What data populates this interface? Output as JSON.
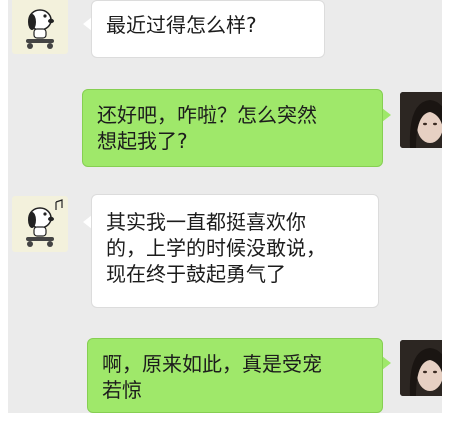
{
  "conversation": {
    "messages": [
      {
        "sender": "friend",
        "lines": [
          "最近过得怎么样?"
        ]
      },
      {
        "sender": "me",
        "lines": [
          "还好吧，咋啦？怎么突然",
          "想起我了?"
        ]
      },
      {
        "sender": "friend",
        "lines": [
          "其实我一直都挺喜欢你",
          "的，上学的时候没敢说，",
          "现在终于鼓起勇气了"
        ]
      },
      {
        "sender": "me",
        "lines": [
          "啊，原来如此，真是受宠",
          "若惊"
        ]
      }
    ]
  },
  "avatars": {
    "friend": {
      "icon": "snoopy-avatar-icon"
    },
    "me": {
      "icon": "user-photo-avatar-icon"
    }
  },
  "colors": {
    "background": "#ebebeb",
    "incoming_bubble": "#ffffff",
    "outgoing_bubble": "#9fe86a"
  }
}
